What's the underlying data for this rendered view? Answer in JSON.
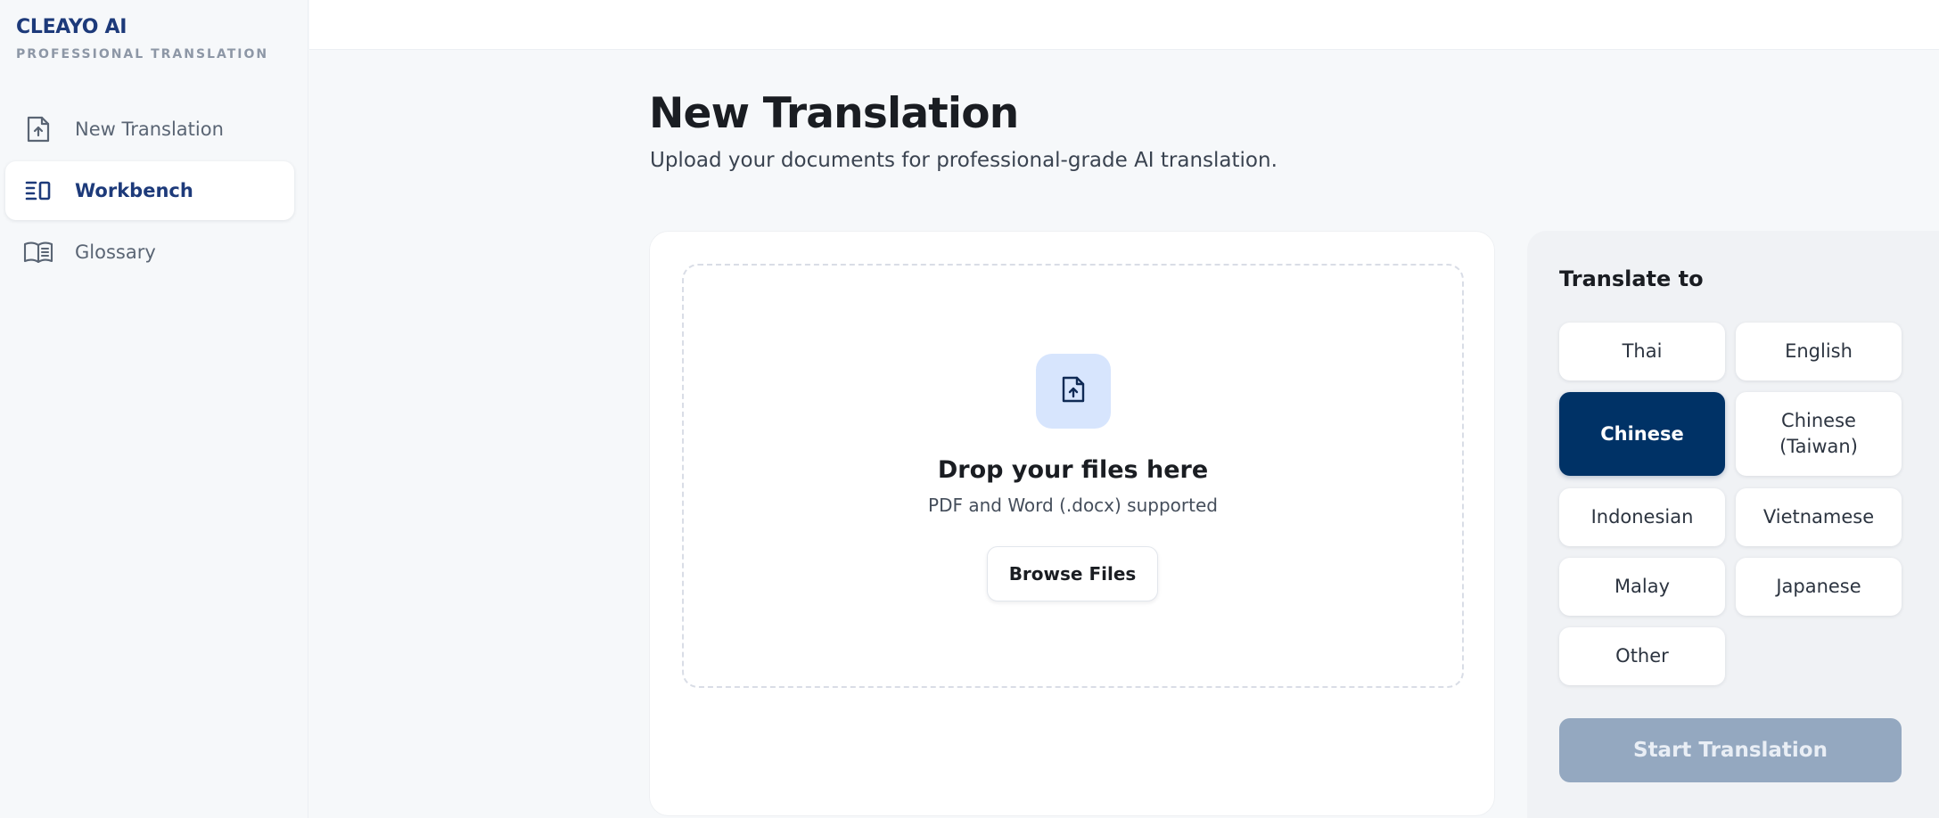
{
  "brand": {
    "title": "CLEAYO AI",
    "subtitle": "PROFESSIONAL TRANSLATION"
  },
  "sidebar": {
    "items": [
      {
        "label": "New Translation",
        "icon": "file-upload-icon",
        "active": false
      },
      {
        "label": "Workbench",
        "icon": "workbench-icon",
        "active": true
      },
      {
        "label": "Glossary",
        "icon": "book-icon",
        "active": false
      }
    ]
  },
  "main": {
    "title": "New Translation",
    "subtitle": "Upload your documents for professional-grade AI translation."
  },
  "upload": {
    "icon": "file-upload-icon",
    "title": "Drop your files here",
    "hint": "PDF and Word (.docx) supported",
    "browse_label": "Browse Files"
  },
  "languages": {
    "heading": "Translate to",
    "options": [
      {
        "label": "Thai",
        "selected": false
      },
      {
        "label": "English",
        "selected": false
      },
      {
        "label": "Chinese",
        "selected": true
      },
      {
        "label": "Chinese (Taiwan)",
        "selected": false
      },
      {
        "label": "Indonesian",
        "selected": false
      },
      {
        "label": "Vietnamese",
        "selected": false
      },
      {
        "label": "Malay",
        "selected": false
      },
      {
        "label": "Japanese",
        "selected": false
      },
      {
        "label": "Other",
        "selected": false
      }
    ],
    "start_label": "Start Translation",
    "start_enabled": false
  },
  "colors": {
    "brand": "#1d3a7a",
    "selected": "#003266",
    "start_disabled": "#94a8c0",
    "drop_icon_bg": "#d7e5fd"
  }
}
